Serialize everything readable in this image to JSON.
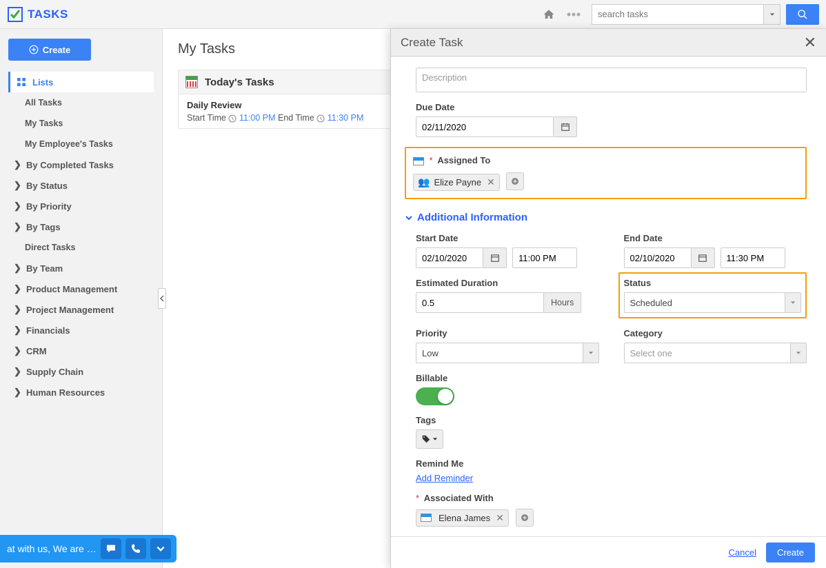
{
  "app": {
    "title": "TASKS",
    "search_placeholder": "search tasks"
  },
  "sidebar": {
    "create_label": "Create",
    "lists_label": "Lists",
    "items": [
      "All Tasks",
      "My Tasks",
      "My Employee's Tasks"
    ],
    "groups": [
      "By Completed Tasks",
      "By Status",
      "By Priority",
      "By Tags",
      "Direct Tasks",
      "By Team",
      "Product Management",
      "Project Management",
      "Financials",
      "CRM",
      "Supply Chain",
      "Human Resources"
    ]
  },
  "content": {
    "page_title": "My Tasks",
    "section_title": "Today's Tasks",
    "task": {
      "name": "Daily Review",
      "start_label": "Start Time",
      "start_value": "11:00 PM",
      "end_label": "End Time",
      "end_value": "11:30 PM"
    }
  },
  "panel": {
    "title": "Create Task",
    "description_placeholder": "Description",
    "due_date": {
      "label": "Due Date",
      "value": "02/11/2020"
    },
    "assigned_to": {
      "label": "Assigned To",
      "value": "Elize Payne"
    },
    "additional_info_label": "Additional Information",
    "start_date": {
      "label": "Start Date",
      "date": "02/10/2020",
      "time": "11:00 PM"
    },
    "end_date": {
      "label": "End Date",
      "date": "02/10/2020",
      "time": "11:30 PM"
    },
    "duration": {
      "label": "Estimated Duration",
      "value": "0.5",
      "unit": "Hours"
    },
    "status": {
      "label": "Status",
      "value": "Scheduled"
    },
    "priority": {
      "label": "Priority",
      "value": "Low"
    },
    "category": {
      "label": "Category",
      "placeholder": "Select one"
    },
    "billable": {
      "label": "Billable",
      "value": true
    },
    "tags": {
      "label": "Tags"
    },
    "remind": {
      "label": "Remind Me",
      "link": "Add Reminder"
    },
    "associated": {
      "label": "Associated With",
      "value": "Elena James"
    },
    "footer": {
      "cancel": "Cancel",
      "create": "Create"
    }
  },
  "chat": {
    "text": "at with us, We are …"
  }
}
